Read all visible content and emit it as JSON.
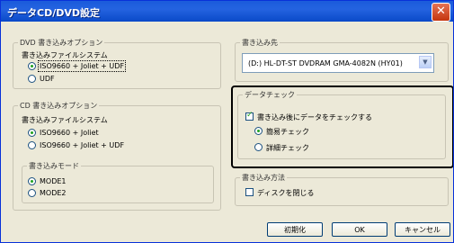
{
  "window": {
    "title": "データCD/DVD設定",
    "close_label": "✕"
  },
  "dvd_options": {
    "title": "DVD 書き込みオプション",
    "fs_title": "書き込みファイルシステム",
    "fs_opt1": "ISO9660 + Joliet + UDF",
    "fs_opt2": "UDF"
  },
  "cd_options": {
    "title": "CD 書き込みオプション",
    "fs_title": "書き込みファイルシステム",
    "fs_opt1": "ISO9660 + Joliet",
    "fs_opt2": "ISO9660 + Joliet + UDF",
    "mode_title": "書き込みモード",
    "mode_opt1": "MODE1",
    "mode_opt2": "MODE2"
  },
  "destination": {
    "title": "書き込み先",
    "drive": "(D:) HL-DT-ST DVDRAM GMA-4082N (HY01)"
  },
  "data_check": {
    "title": "データチェック",
    "checkbox_label": "書き込み後にデータをチェックする",
    "simple": "簡易チェック",
    "detailed": "詳細チェック"
  },
  "write_method": {
    "title": "書き込み方法",
    "close_disc": "ディスクを閉じる"
  },
  "buttons": {
    "reset": "初期化",
    "ok": "OK",
    "cancel": "キャンセル"
  },
  "colors": {
    "title_bar": "#0a49c8",
    "radio_dot": "#21a121",
    "highlight_border": "#000000"
  }
}
